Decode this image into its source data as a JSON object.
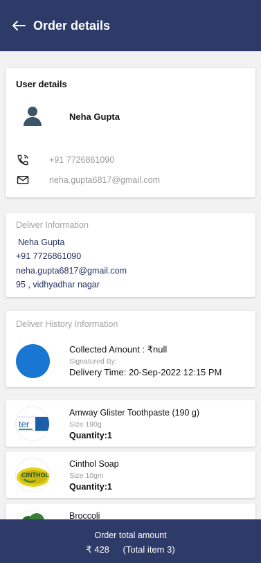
{
  "header": {
    "title": "Order details",
    "back_icon": "arrow-left-icon"
  },
  "user_details": {
    "heading": "User details",
    "name": "Neha Gupta",
    "phone": "+91 7726861090",
    "email": "neha.gupta6817@gmail.com"
  },
  "deliver_information": {
    "heading": "Deliver Information",
    "name": "Neha Gupta",
    "phone": "+91 7726861090",
    "email": "neha.gupta6817@gmail.com",
    "address": "95 , vidhyadhar nagar"
  },
  "deliver_history": {
    "heading": "Deliver History Information",
    "collected_amount": "Collected Amount :  ₹null",
    "signatured_by": "Signatured By:",
    "delivery_time": "Delivery Time:  20-Sep-2022  12:15 PM",
    "status_color": "#1976d2"
  },
  "products": [
    {
      "name": "Amway Glister Toothpaste (190 g)",
      "size": "Size 190g",
      "quantity": "Quantity:1"
    },
    {
      "name": "Cinthol Soap",
      "size": "Size 10gm",
      "quantity": "Quantity:1"
    },
    {
      "name": "Broccoli",
      "size": "",
      "quantity": ""
    }
  ],
  "footer": {
    "label": "Order total amount",
    "amount": "₹ 428",
    "items": "(Total item 3)"
  },
  "colors": {
    "primary": "#2e3a67",
    "accent": "#1976d2"
  }
}
